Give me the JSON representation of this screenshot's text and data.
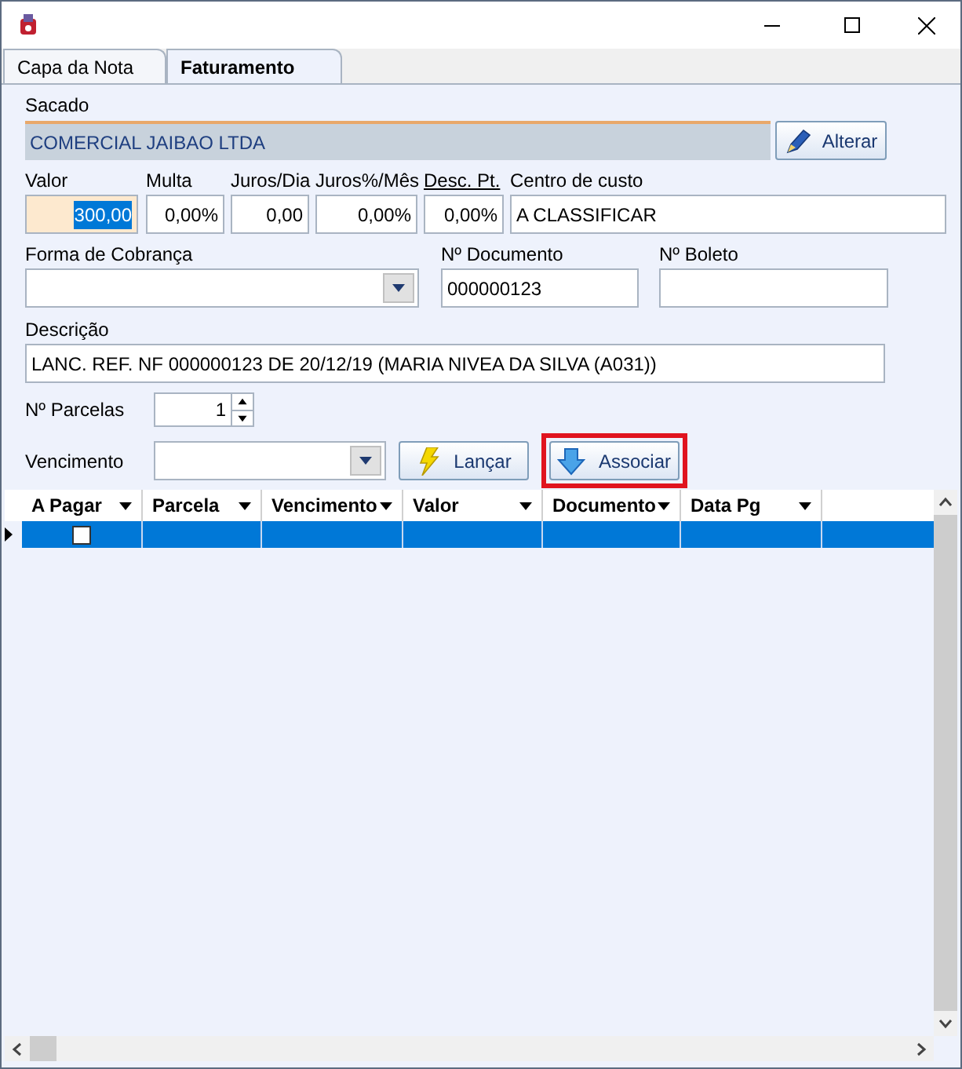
{
  "tabs": [
    {
      "label": "Capa da Nota",
      "selected": false
    },
    {
      "label": "Faturamento",
      "selected": true
    }
  ],
  "sacado": {
    "label": "Sacado",
    "value": "COMERCIAL JAIBAO LTDA",
    "button": "Alterar"
  },
  "values": [
    {
      "label": "Valor",
      "value": "300,00",
      "selected": true,
      "underlined": false
    },
    {
      "label": "Multa",
      "value": "0,00%",
      "selected": false,
      "underlined": false
    },
    {
      "label": "Juros/Dia",
      "value": "0,00",
      "selected": false,
      "underlined": false
    },
    {
      "label": "Juros%/Mês",
      "value": "0,00%",
      "selected": false,
      "underlined": false
    },
    {
      "label": "Desc. Pt.",
      "value": "0,00%",
      "selected": false,
      "underlined": true
    },
    {
      "label": "Centro de custo",
      "value": "A CLASSIFICAR",
      "selected": false,
      "underlined": false
    }
  ],
  "forma_cobranca": {
    "label": "Forma de Cobrança"
  },
  "documento": {
    "label": "Nº Documento",
    "value": "000000123"
  },
  "boleto": {
    "label": "Nº Boleto"
  },
  "descricao": {
    "label": "Descrição",
    "value": "LANC. REF. NF 000000123 DE 20/12/19 (MARIA NIVEA DA SILVA (A031))"
  },
  "parcelas": {
    "label": "Nº Parcelas",
    "value": "1"
  },
  "vencimento": {
    "label": "Vencimento"
  },
  "buttons": [
    {
      "label": "Lançar",
      "kind": "flash",
      "highlighted": false
    },
    {
      "label": "Associar",
      "kind": "down",
      "highlighted": true
    }
  ],
  "grid": {
    "columns": [
      "A Pagar",
      "Parcela",
      "Vencimento",
      "Valor",
      "Documento",
      "Data Pg"
    ],
    "rows": [
      {
        "selected": true,
        "checked": false
      }
    ]
  }
}
